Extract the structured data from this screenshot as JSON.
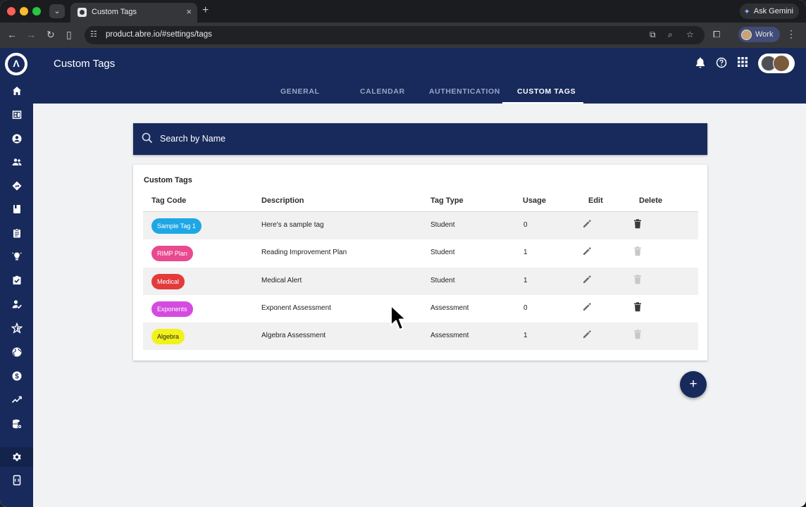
{
  "browser": {
    "tab_title": "Custom Tags",
    "url": "product.abre.io/#settings/tags",
    "gemini_label": "Ask Gemini",
    "profile_label": "Work"
  },
  "app": {
    "title": "Custom Tags",
    "nav_tabs": [
      "GENERAL",
      "CALENDAR",
      "AUTHENTICATION",
      "CUSTOM TAGS"
    ],
    "active_tab": "CUSTOM TAGS"
  },
  "search": {
    "placeholder": "Search by Name"
  },
  "table": {
    "title": "Custom Tags",
    "headers": {
      "tag_code": "Tag Code",
      "description": "Description",
      "tag_type": "Tag Type",
      "usage": "Usage",
      "edit": "Edit",
      "delete": "Delete"
    },
    "rows": [
      {
        "tag": "Sample Tag 1",
        "color": "#1ea7e4",
        "text_color": "#ffffff",
        "description": "Here's a sample tag",
        "type": "Student",
        "usage": "0",
        "delete_enabled": true
      },
      {
        "tag": "RIMP Plan",
        "color": "#e8498f",
        "text_color": "#ffffff",
        "description": "Reading Improvement Plan",
        "type": "Student",
        "usage": "1",
        "delete_enabled": false
      },
      {
        "tag": "Medical",
        "color": "#e33b3b",
        "text_color": "#ffffff",
        "description": "Medical Alert",
        "type": "Student",
        "usage": "1",
        "delete_enabled": false
      },
      {
        "tag": "Exponents",
        "color": "#d44be0",
        "text_color": "#ffffff",
        "description": "Exponent Assessment",
        "type": "Assessment",
        "usage": "0",
        "delete_enabled": true
      },
      {
        "tag": "Algebra",
        "color": "#f2f21a",
        "text_color": "#202124",
        "description": "Algebra Assessment",
        "type": "Assessment",
        "usage": "1",
        "delete_enabled": false
      }
    ]
  },
  "fab_label": "+",
  "rail_icons": [
    "home-icon",
    "dashboard-icon",
    "account-icon",
    "people-icon",
    "directions-icon",
    "book-icon",
    "clipboard-icon",
    "lightbulb-icon",
    "task-icon",
    "person-check-icon",
    "star-icon",
    "globe-icon",
    "dollar-icon",
    "trending-icon",
    "database-icon",
    "settings-icon",
    "tablet-icon"
  ],
  "colors": {
    "brand_navy": "#172a5b",
    "page_bg": "#f1f2f4"
  }
}
